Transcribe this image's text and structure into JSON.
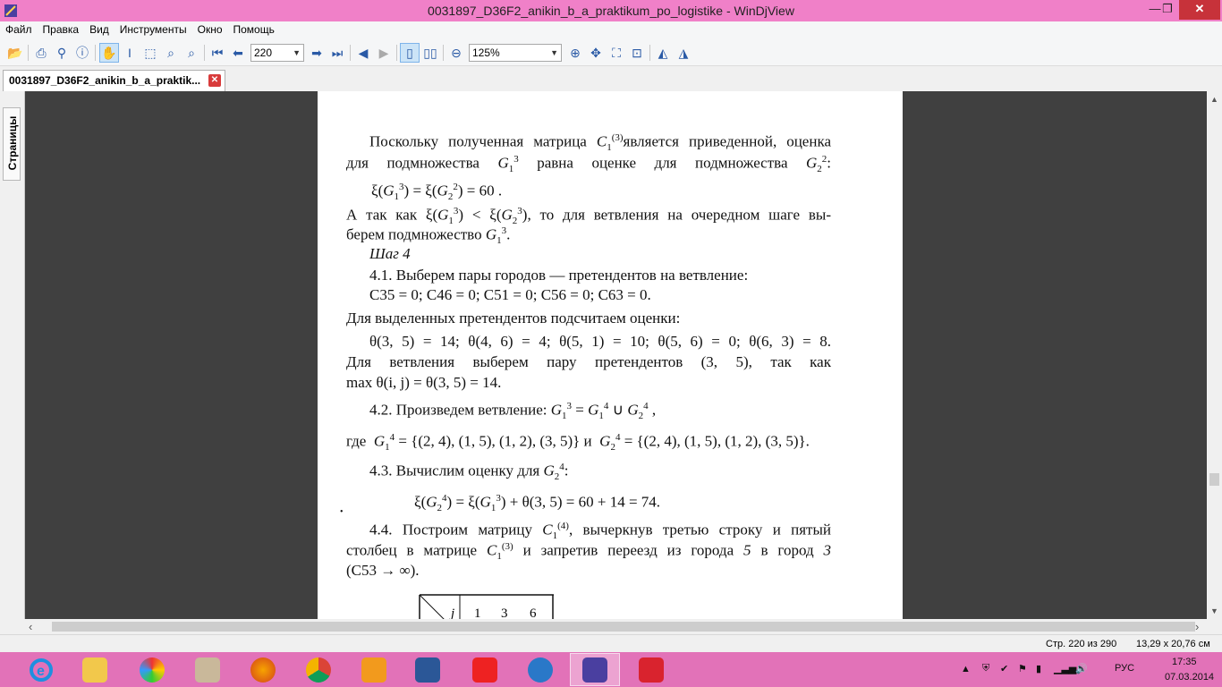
{
  "window": {
    "title": "0031897_D36F2_anikin_b_a_praktikum_po_logistike - WinDjView"
  },
  "menu": [
    "Файл",
    "Правка",
    "Вид",
    "Инструменты",
    "Окно",
    "Помощь"
  ],
  "toolbar": {
    "page_value": "220",
    "zoom_value": "125%"
  },
  "tab": {
    "label": "0031897_D36F2_anikin_b_a_praktik..."
  },
  "sidebar": {
    "pages_tab_label": "Страницы"
  },
  "document": {
    "p1_a": "Поскольку полученная матрица",
    "p1_b": "является приведенной, оценка",
    "p1_c": "для подмножества",
    "p1_d": "равна оценке для подмножества",
    "eq1": "= 60 .",
    "p2_a": "А так как",
    "p2_b": ", то для ветвления на очередном шаге вы-",
    "p2_c": "берем подмножество",
    "step": "Шаг 4",
    "s41": "4.1. Выберем пары городов — претендентов на ветвление:",
    "c_list": "C35 = 0; C46 = 0; C51 = 0; C56 = 0; C63 = 0.",
    "p3": "Для выделенных претендентов подсчитаем оценки:",
    "theta": "θ(3, 5) = 14; θ(4, 6) = 4; θ(5, 1) = 10; θ(5, 6) = 0; θ(6, 3) = 8.",
    "p4": "Для ветвления выберем пару претендентов (3, 5), так как",
    "p5": "max θ(i, j) = θ(3, 5) = 14.",
    "s42": "4.2. Произведем ветвление:",
    "gde": "где",
    "set1": "= {(2, 4), (1, 5), (1, 2), (3, 5)}  и",
    "set2": "= {(2, 4), (1, 5), (1, 2), (3, 5)}.",
    "s43": "4.3. Вычислим оценку для",
    "eq2": "+ θ(3, 5) = 60 + 14 = 74.",
    "s44_a": "4.4. Построим матрицу",
    "s44_b": ", вычеркнув третью строку и пятый",
    "s44_c": "столбец в матрице",
    "s44_d": "и запретив переезд из города",
    "s44_e": "в город",
    "city5": "5",
    "city3": "3",
    "s44_f": "(C53 → ∞).",
    "table_header": [
      "j",
      "1",
      "3",
      "6"
    ]
  },
  "status": {
    "page": "Стр. 220 из 290",
    "size": "13,29 x 20,76 см"
  },
  "taskbar": {
    "apps": [
      "internet-explorer-icon",
      "file-explorer-icon",
      "colorful-app-icon",
      "archive-icon",
      "firefox-icon",
      "chrome-icon",
      "media-player-icon",
      "word-icon",
      "yandex-icon",
      "audio-icon",
      "windjview-icon",
      "red-app-icon"
    ],
    "lang": "РУС",
    "time": "17:35",
    "date": "07.03.2014"
  }
}
